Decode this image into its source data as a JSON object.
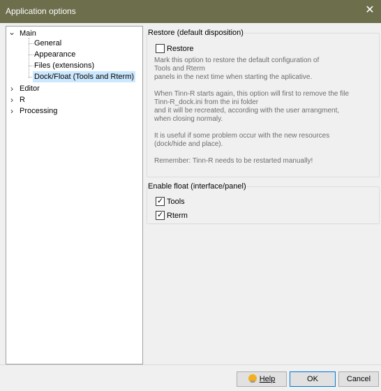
{
  "window": {
    "title": "Application options",
    "close_glyph": "✕"
  },
  "tree": {
    "main": {
      "label": "Main",
      "toggle": "⌄"
    },
    "main_children": [
      {
        "label": "General"
      },
      {
        "label": "Appearance"
      },
      {
        "label": "Files (extensions)"
      },
      {
        "label": "Dock/Float (Tools and Rterm)"
      }
    ],
    "others": [
      {
        "label": "Editor",
        "toggle": "›"
      },
      {
        "label": "R",
        "toggle": "›"
      },
      {
        "label": "Processing",
        "toggle": "›"
      }
    ]
  },
  "restore": {
    "caption": "Restore (default disposition)",
    "checkbox_label": "Restore",
    "checked": false,
    "lines": [
      "Mark this option to restore the default configuration of",
      "Tools and Rterm",
      "panels in the next time when starting the aplicative.",
      "",
      "When Tinn-R starts again, this option will first to remove the file",
      "Tinn-R_dock.ini from the ini folder",
      "and it will be recreated, according with the user arrangment,",
      "when closing normaly.",
      "",
      "It is useful if some problem occur with the new resources",
      "(dock/hide and place).",
      "",
      "Remember: Tinn-R needs to be restarted manually!"
    ]
  },
  "float": {
    "caption": "Enable float (interface/panel)",
    "tools_label": "Tools",
    "tools_checked": true,
    "rterm_label": "Rterm",
    "rterm_checked": true,
    "tick_glyph": "✓"
  },
  "footer": {
    "help_label": "Help",
    "ok_label": "OK",
    "cancel_label": "Cancel"
  },
  "colors": {
    "titlebar": "#6c6e4c",
    "selection": "#cce8ff",
    "default_button_border": "#0078d7"
  }
}
